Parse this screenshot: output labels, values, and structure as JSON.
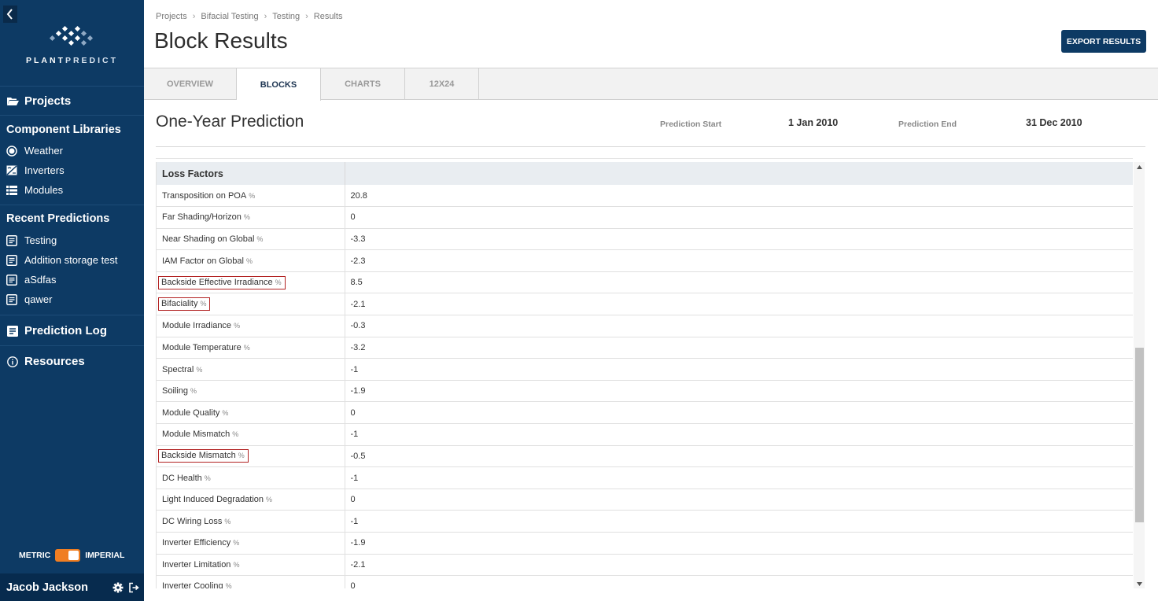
{
  "sidebar": {
    "logo_text_bold": "PLANT",
    "logo_text_light": "PREDICT",
    "projects_label": "Projects",
    "component_libraries_title": "Component Libraries",
    "libraries": [
      {
        "label": "Weather",
        "icon": "sun-icon"
      },
      {
        "label": "Inverters",
        "icon": "inverter-icon"
      },
      {
        "label": "Modules",
        "icon": "module-icon"
      }
    ],
    "recent_predictions_title": "Recent Predictions",
    "recent": [
      {
        "label": "Testing",
        "icon": "document-icon"
      },
      {
        "label": "Addition storage test",
        "icon": "document-icon"
      },
      {
        "label": "aSdfas",
        "icon": "document-icon"
      },
      {
        "label": "qawer",
        "icon": "document-icon"
      }
    ],
    "prediction_log_label": "Prediction Log",
    "resources_label": "Resources",
    "unit_metric": "METRIC",
    "unit_imperial": "IMPERIAL",
    "user_name": "Jacob Jackson",
    "accent_color": "#f07e22",
    "background_color": "#0d3a64"
  },
  "breadcrumb": {
    "items": [
      "Projects",
      "Bifacial Testing",
      "Testing",
      "Results"
    ]
  },
  "header": {
    "title": "Block Results",
    "export_label": "EXPORT RESULTS"
  },
  "tabs": [
    {
      "label": "OVERVIEW",
      "active": false
    },
    {
      "label": "BLOCKS",
      "active": true
    },
    {
      "label": "CHARTS",
      "active": false
    },
    {
      "label": "12X24",
      "active": false
    }
  ],
  "prediction": {
    "heading": "One-Year Prediction",
    "start_label": "Prediction Start",
    "start_value": "1 Jan 2010",
    "end_label": "Prediction End",
    "end_value": "31 Dec 2010"
  },
  "table": {
    "header_left": "Loss Factors",
    "header_right": "",
    "unit": "%",
    "rows": [
      {
        "label": "Transposition on POA",
        "value": "20.8",
        "highlighted": false
      },
      {
        "label": "Far Shading/Horizon",
        "value": "0",
        "highlighted": false
      },
      {
        "label": "Near Shading on Global",
        "value": "-3.3",
        "highlighted": false
      },
      {
        "label": "IAM Factor on Global",
        "value": "-2.3",
        "highlighted": false
      },
      {
        "label": "Backside Effective Irradiance",
        "value": "8.5",
        "highlighted": true
      },
      {
        "label": "Bifaciality",
        "value": "-2.1",
        "highlighted": true
      },
      {
        "label": "Module Irradiance",
        "value": "-0.3",
        "highlighted": false
      },
      {
        "label": "Module Temperature",
        "value": "-3.2",
        "highlighted": false
      },
      {
        "label": "Spectral",
        "value": "-1",
        "highlighted": false
      },
      {
        "label": "Soiling",
        "value": "-1.9",
        "highlighted": false
      },
      {
        "label": "Module Quality",
        "value": "0",
        "highlighted": false
      },
      {
        "label": "Module Mismatch",
        "value": "-1",
        "highlighted": false
      },
      {
        "label": "Backside Mismatch",
        "value": "-0.5",
        "highlighted": true
      },
      {
        "label": "DC Health",
        "value": "-1",
        "highlighted": false
      },
      {
        "label": "Light Induced Degradation",
        "value": "0",
        "highlighted": false
      },
      {
        "label": "DC Wiring Loss",
        "value": "-1",
        "highlighted": false
      },
      {
        "label": "Inverter Efficiency",
        "value": "-1.9",
        "highlighted": false
      },
      {
        "label": "Inverter Limitation",
        "value": "-2.1",
        "highlighted": false
      },
      {
        "label": "Inverter Cooling",
        "value": "0",
        "highlighted": false
      }
    ],
    "highlight_color": "#b22222"
  }
}
